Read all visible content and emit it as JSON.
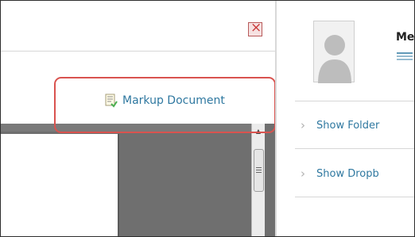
{
  "markup": {
    "label": "Markup Document",
    "icon": "document-markup-icon"
  },
  "close": {
    "icon": "close-icon",
    "glyph": "×"
  },
  "user": {
    "name": "Me",
    "avatar": "avatar-placeholder"
  },
  "right_panel": {
    "items": [
      {
        "label": "Show Folder",
        "icon": "chevron-right-icon",
        "glyph": "›"
      },
      {
        "label": "Show Dropb",
        "icon": "chevron-right-icon",
        "glyph": "›"
      }
    ]
  },
  "colors": {
    "link": "#2f78a0",
    "highlight": "#d9534f",
    "viewer": "#6f6f6f"
  },
  "scrollbar": {
    "up_glyph": "▲"
  }
}
